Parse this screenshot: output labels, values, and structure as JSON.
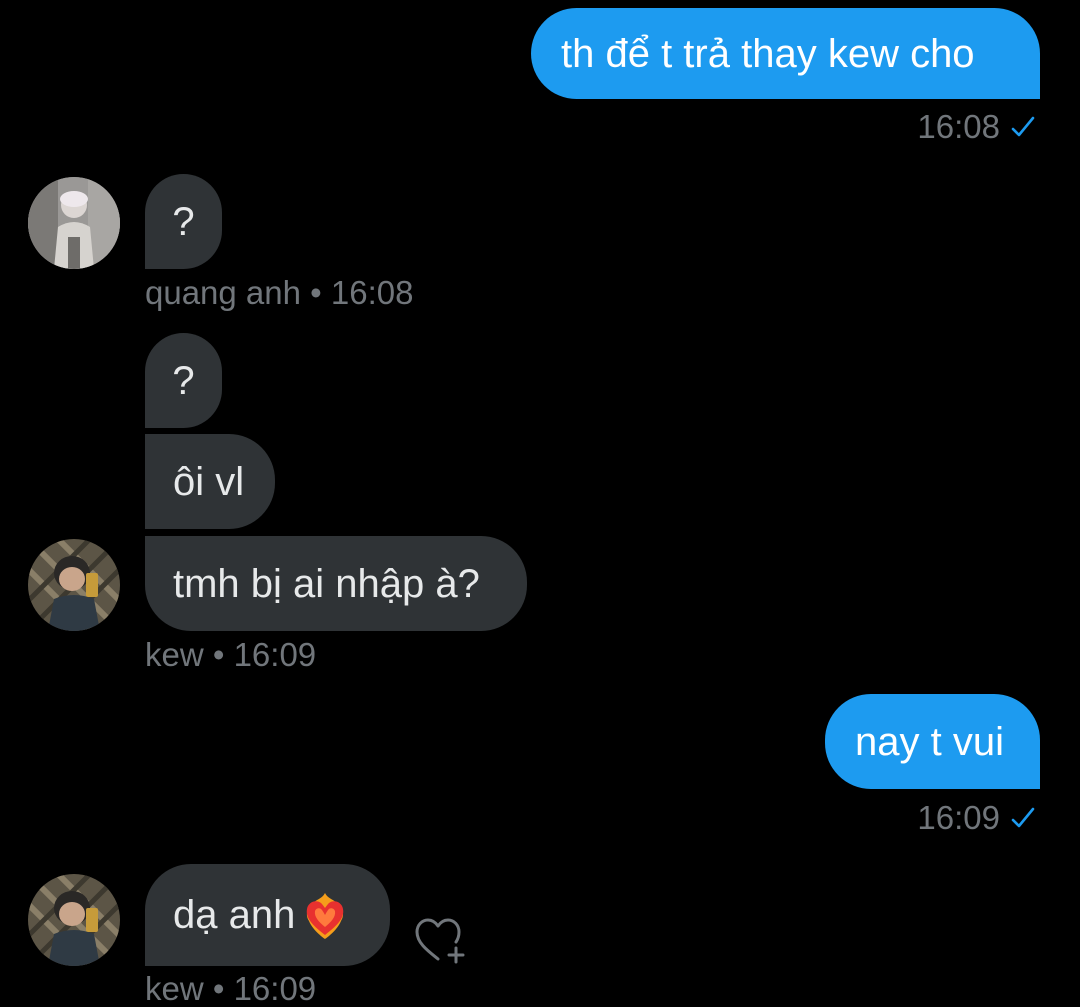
{
  "conversation": {
    "messages": [
      {
        "id": "m1",
        "direction": "outgoing",
        "text": "th để t trả thay kew cho"
      },
      {
        "id": "m2",
        "direction": "incoming",
        "text": "?"
      },
      {
        "id": "m3",
        "direction": "incoming",
        "text": "?"
      },
      {
        "id": "m4",
        "direction": "incoming",
        "text": "ôi vl"
      },
      {
        "id": "m5",
        "direction": "incoming",
        "text": "tmh bị ai nhập à?"
      },
      {
        "id": "m6",
        "direction": "outgoing",
        "text": "nay t vui"
      },
      {
        "id": "m7",
        "direction": "incoming",
        "text": "dạ anh",
        "emoji": "heart-on-fire"
      }
    ],
    "meta": {
      "m1_time": "16:08",
      "m2_sender_time": "quang anh • 16:08",
      "m5_sender_time": "kew • 16:09",
      "m6_time": "16:09",
      "m7_sender_time": "kew • 16:09"
    },
    "avatars": {
      "quang_anh": "avatar-quang-anh",
      "kew": "avatar-kew"
    },
    "icons": {
      "read_check": "check-icon",
      "react": "heart-plus-icon",
      "emoji": "heart-on-fire-icon"
    }
  },
  "colors": {
    "background": "#000000",
    "outgoing_bubble": "#1d9bf0",
    "incoming_bubble": "#2f3336",
    "meta_text": "#71767b",
    "check": "#1d9bf0"
  }
}
